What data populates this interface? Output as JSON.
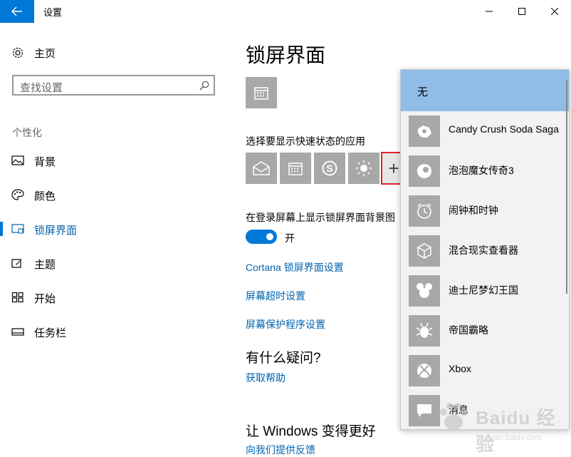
{
  "titlebar": {
    "title": "设置"
  },
  "sidebar": {
    "home_label": "主页",
    "search_placeholder": "查找设置",
    "section_label": "个性化",
    "items": [
      {
        "label": "背景"
      },
      {
        "label": "颜色"
      },
      {
        "label": "锁屏界面"
      },
      {
        "label": "主题"
      },
      {
        "label": "开始"
      },
      {
        "label": "任务栏"
      }
    ]
  },
  "main": {
    "page_title": "锁屏界面",
    "quick_status_label": "选择要显示快速状态的应用",
    "quick_apps": [
      {
        "icon": "mail-icon"
      },
      {
        "icon": "calendar-icon"
      },
      {
        "icon": "skype-icon"
      },
      {
        "icon": "weather-icon"
      }
    ],
    "add_symbol": "+",
    "background_toggle_label": "在登录屏幕上显示锁屏界面背景图",
    "toggle_state": "开",
    "links": [
      "Cortana 锁屏界面设置",
      "屏幕超时设置",
      "屏幕保护程序设置"
    ],
    "question_heading": "有什么疑问?",
    "help_link": "获取帮助",
    "improve_heading": "让 Windows 变得更好",
    "feedback_link": "向我们提供反馈"
  },
  "dropdown": {
    "selected": "无",
    "items": [
      {
        "label": "Candy Crush Soda Saga"
      },
      {
        "label": "泡泡魔女传奇3"
      },
      {
        "label": "闹钟和时钟"
      },
      {
        "label": "混合现实查看器"
      },
      {
        "label": "迪士尼梦幻王国"
      },
      {
        "label": "帝国霸略"
      },
      {
        "label": "Xbox"
      },
      {
        "label": "消息"
      }
    ]
  },
  "watermark": {
    "text": "Baidu 经验",
    "sub": "jingyan.baidu.com"
  },
  "colors": {
    "accent": "#0078d7",
    "link": "#0063b1",
    "tile": "#a8a8a8",
    "selection": "#8fbde8",
    "highlight": "#e0212b"
  }
}
